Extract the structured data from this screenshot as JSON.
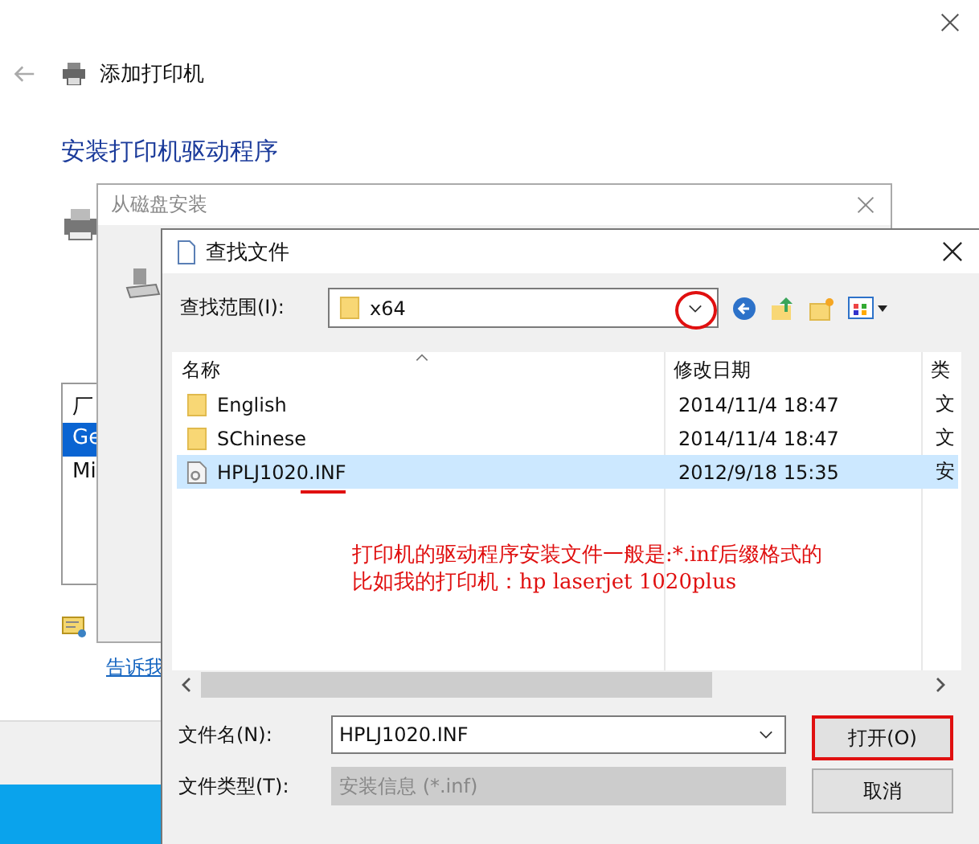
{
  "base_window": {
    "title": "添加打印机",
    "heading": "安装打印机驱动程序",
    "list_items": [
      {
        "label": "厂",
        "selected": false
      },
      {
        "label": "Ge",
        "selected": true
      },
      {
        "label": "Mi",
        "selected": false
      }
    ],
    "link": "告诉我"
  },
  "disk_dialog": {
    "title": "从磁盘安装"
  },
  "file_dialog": {
    "title": "查找文件",
    "look_in_label": "查找范围(I):",
    "look_in_value": "x64",
    "look_in_circled": true,
    "columns": [
      "名称",
      "修改日期",
      "类"
    ],
    "rows": [
      {
        "kind": "folder",
        "name": "English",
        "date": "2014/11/4 18:47",
        "type": "文",
        "selected": false,
        "underlined": false
      },
      {
        "kind": "folder",
        "name": "SChinese",
        "date": "2014/11/4 18:47",
        "type": "文",
        "selected": false,
        "underlined": false
      },
      {
        "kind": "file",
        "name": "HPLJ1020.INF",
        "date": "2012/9/18 15:35",
        "type": "安",
        "selected": true,
        "underlined": true
      }
    ],
    "filename_label": "文件名(N):",
    "filename_value": "HPLJ1020.INF",
    "filetype_label": "文件类型(T):",
    "filetype_value": "安装信息 (*.inf)",
    "filetype_disabled": true,
    "buttons": [
      {
        "label": "打开(O)",
        "highlighted": true
      },
      {
        "label": "取消",
        "highlighted": false
      }
    ]
  },
  "annotation": {
    "lines": [
      "打印机的驱动程序安装文件一般是:*.inf后缀格式的",
      "比如我的打印机：hp laserjet 1020plus"
    ]
  }
}
